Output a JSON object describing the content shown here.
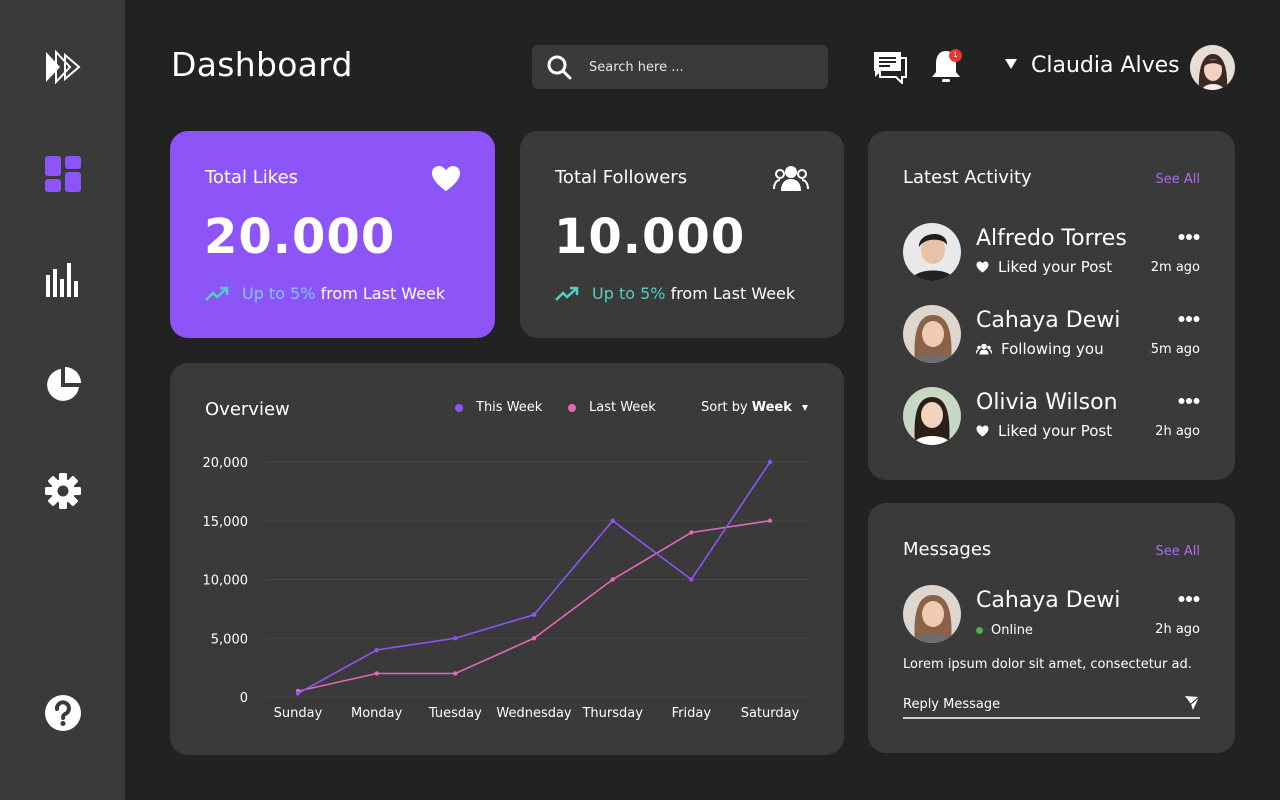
{
  "header": {
    "title": "Dashboard",
    "search_placeholder": "Search here ...",
    "notification_count": "1",
    "user_name": "Claudia Alves"
  },
  "sidebar": {
    "items": [
      {
        "icon": "logo-icon"
      },
      {
        "icon": "dashboard-icon",
        "active": true
      },
      {
        "icon": "bar-chart-icon"
      },
      {
        "icon": "pie-chart-icon"
      },
      {
        "icon": "gear-icon"
      },
      {
        "icon": "help-icon"
      }
    ]
  },
  "colors": {
    "accent": "#8d55f8",
    "pink": "#e668b8",
    "trend": "#4fd1c5",
    "link": "#b06cf0"
  },
  "stats": {
    "likes": {
      "title": "Total Likes",
      "value": "20.000",
      "trend_highlight": "Up to 5%",
      "trend_rest": " from Last Week",
      "icon": "heart-icon"
    },
    "followers": {
      "title": "Total Followers",
      "value": "10.000",
      "trend_highlight": "Up to 5%",
      "trend_rest": " from Last Week",
      "icon": "users-icon"
    }
  },
  "overview": {
    "title": "Overview",
    "legend": [
      "This Week",
      "Last Week"
    ],
    "sort_label": "Sort by",
    "sort_value": "Week"
  },
  "chart_data": {
    "type": "line",
    "categories": [
      "Sunday",
      "Monday",
      "Tuesday",
      "Wednesday",
      "Thursday",
      "Friday",
      "Saturday"
    ],
    "series": [
      {
        "name": "This Week",
        "color": "#8d55f8",
        "values": [
          300,
          4000,
          5000,
          7000,
          15000,
          10000,
          20000
        ]
      },
      {
        "name": "Last Week",
        "color": "#e668b8",
        "values": [
          500,
          2000,
          2000,
          5000,
          10000,
          14000,
          15000
        ]
      }
    ],
    "yticks": [
      0,
      5000,
      10000,
      15000,
      20000
    ],
    "ytick_labels": [
      "0",
      "5,000",
      "10,000",
      "15,000",
      "20,000"
    ],
    "ylim": [
      0,
      20000
    ],
    "grid": true
  },
  "activity": {
    "title": "Latest Activity",
    "see_all": "See All",
    "items": [
      {
        "name": "Alfredo Torres",
        "action": "Liked your Post",
        "action_icon": "heart-icon",
        "time": "2m ago"
      },
      {
        "name": "Cahaya Dewi",
        "action": "Following you",
        "action_icon": "users-icon",
        "time": "5m ago"
      },
      {
        "name": "Olivia Wilson",
        "action": "Liked your Post",
        "action_icon": "heart-icon",
        "time": "2h ago"
      }
    ]
  },
  "messages": {
    "title": "Messages",
    "see_all": "See All",
    "name": "Cahaya Dewi",
    "status": "Online",
    "time": "2h ago",
    "text": "Lorem ipsum dolor sit amet, consectetur ad.",
    "reply_placeholder": "Reply Message"
  }
}
